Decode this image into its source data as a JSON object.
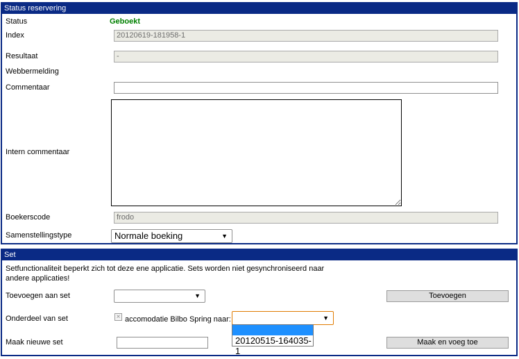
{
  "status_panel": {
    "title": "Status reservering",
    "status_label": "Status",
    "status_value": "Geboekt",
    "status_color": "#008000",
    "index_label": "Index",
    "index_value": "20120619-181958-1",
    "resultaat_label": "Resultaat",
    "resultaat_value": "-",
    "webbermelding_label": "Webbermelding",
    "commentaar_label": "Commentaar",
    "commentaar_value": "",
    "intern_label": "Intern commentaar",
    "intern_value": "",
    "boekerscode_label": "Boekerscode",
    "boekerscode_value": "frodo",
    "samenstelling_label": "Samenstellingstype",
    "samenstelling_value": "Normale boeking"
  },
  "set_panel": {
    "title": "Set",
    "info_line1": "Setfunctionaliteit beperkt zich tot deze ene applicatie. Sets worden niet gesynchroniseerd naar",
    "info_line2": "andere applicaties!",
    "toevoegen_label": "Toevoegen aan set",
    "toevoegen_value": "",
    "toevoegen_button": "Toevoegen",
    "onderdeel_label": "Onderdeel van set",
    "onderdeel_checkbox_text": "accomodatie Bilbo Spring naar:",
    "onderdeel_value": "",
    "dropdown_options": [
      "",
      "20120515-164035-1"
    ],
    "nieuwe_label": "Maak nieuwe set",
    "nieuwe_value": "",
    "nieuwe_button": "Maak en voeg toe"
  },
  "colors": {
    "panel_header": "#0a2a85",
    "dropdown_highlight": "#1e90ff",
    "focus_border": "#e07b00"
  }
}
